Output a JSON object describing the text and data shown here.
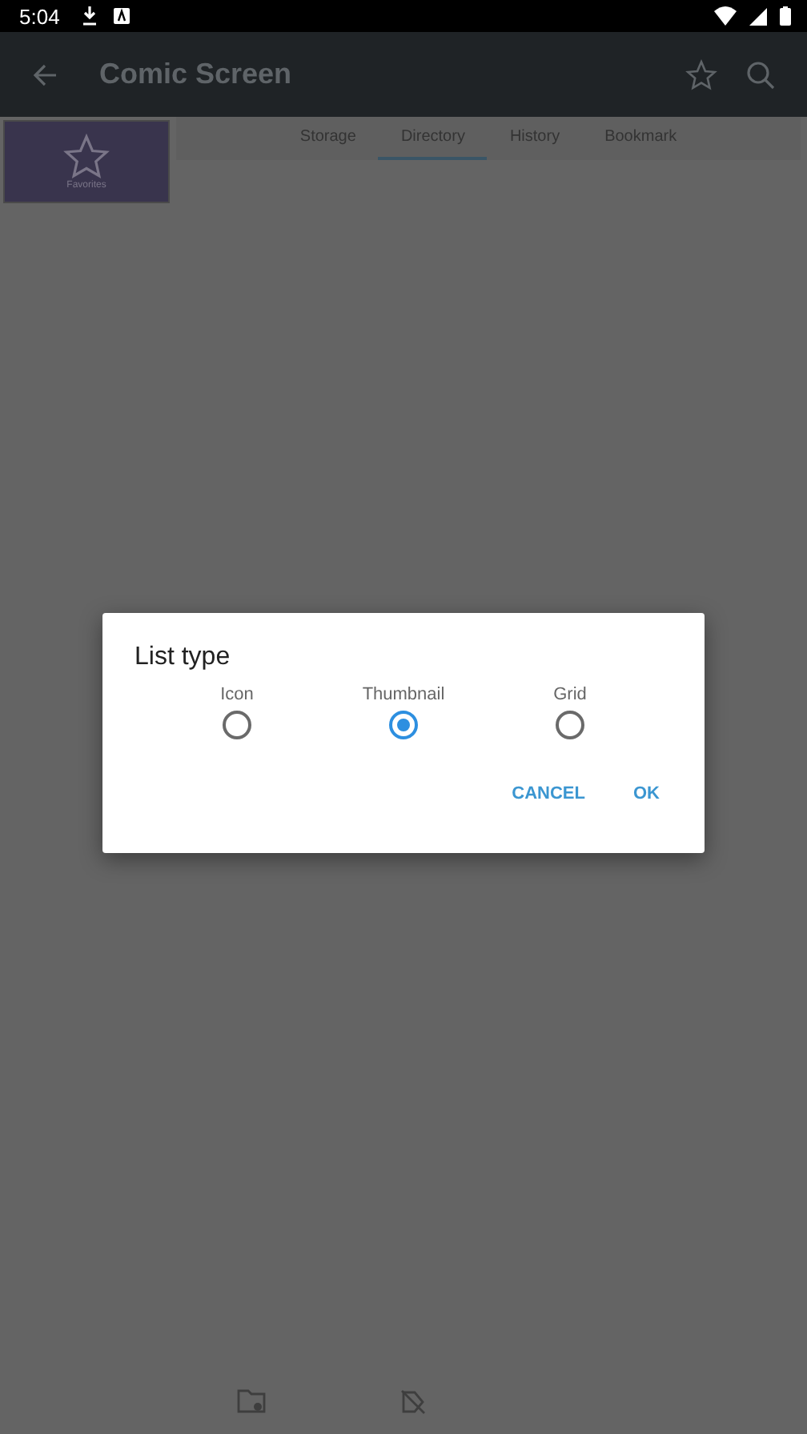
{
  "status_bar": {
    "time": "5:04"
  },
  "app_bar": {
    "title": "Comic Screen"
  },
  "tabs": [
    {
      "label": "Storage",
      "selected": false
    },
    {
      "label": "Directory",
      "selected": true
    },
    {
      "label": "History",
      "selected": false
    },
    {
      "label": "Bookmark",
      "selected": false
    }
  ],
  "favorites_tile": {
    "label": "Favorites"
  },
  "dialog": {
    "title": "List type",
    "options": [
      {
        "label": "Icon",
        "selected": false
      },
      {
        "label": "Thumbnail",
        "selected": true
      },
      {
        "label": "Grid",
        "selected": false
      }
    ],
    "buttons": [
      "CANCEL",
      "OK"
    ]
  }
}
